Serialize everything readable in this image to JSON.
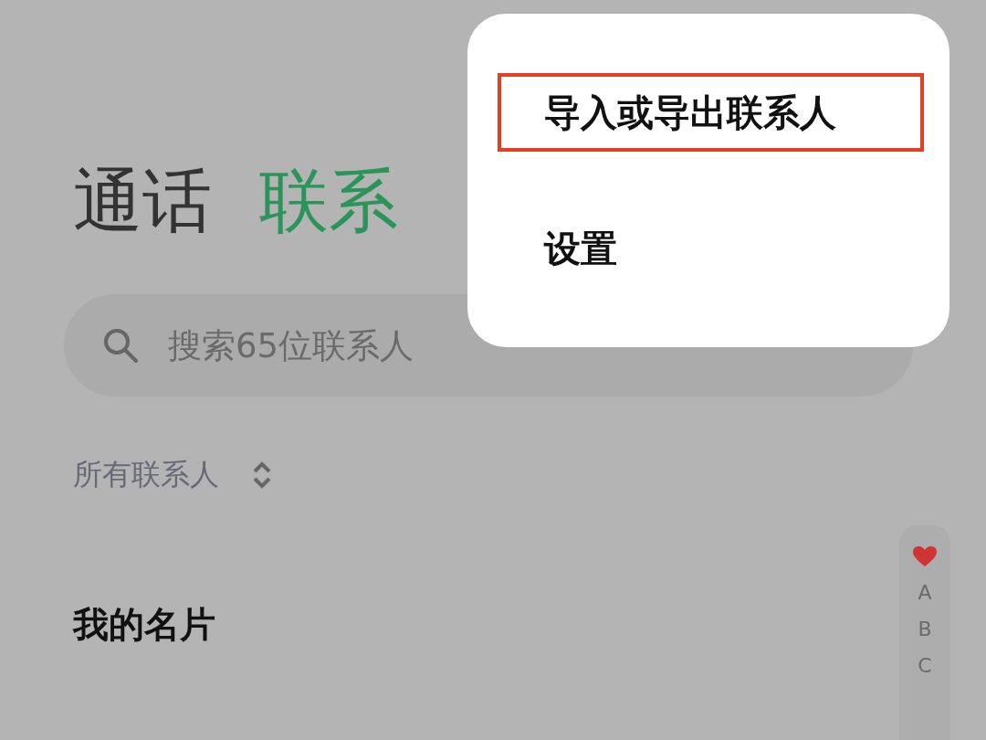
{
  "tabs": [
    {
      "label": "通话",
      "selected": false
    },
    {
      "label": "联系",
      "selected": true
    }
  ],
  "search": {
    "placeholder": "搜索65位联系人"
  },
  "filter": {
    "label": "所有联系人"
  },
  "section": {
    "title": "我的名片"
  },
  "index_bar": {
    "items": [
      {
        "kind": "favorite"
      },
      {
        "kind": "letter",
        "label": "A"
      },
      {
        "kind": "letter",
        "label": "B"
      },
      {
        "kind": "letter",
        "label": "C"
      }
    ]
  },
  "menu": {
    "items": [
      {
        "label": "导入或导出联系人",
        "highlighted": true
      },
      {
        "label": "设置",
        "highlighted": false
      }
    ]
  }
}
